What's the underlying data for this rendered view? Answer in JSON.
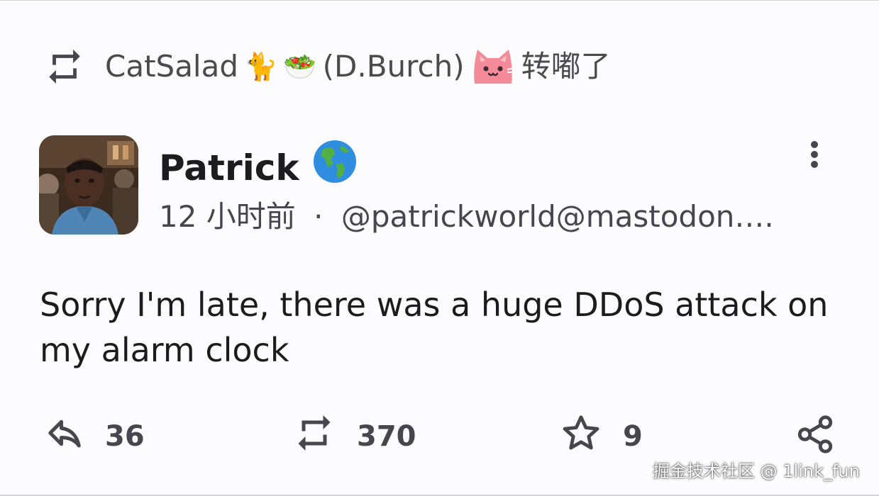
{
  "boost": {
    "icon": "repeat-icon",
    "display_name": "CatSalad",
    "name_emojis": [
      "🐈",
      "🥗"
    ],
    "handle_paren": "(D.Burch)",
    "custom_emoji": "pink-cat-emoji",
    "action_text": "转嘟了"
  },
  "post": {
    "author": {
      "name": "Patrick",
      "name_emoji": "🌎"
    },
    "meta": {
      "time": "12 小时前",
      "separator": "·",
      "account": "@patrickworld@mastodon…."
    },
    "body": "Sorry I'm late, there was a huge DDoS attack on my alarm clock"
  },
  "actions": {
    "reply": {
      "icon": "reply-icon",
      "count": "36"
    },
    "boost": {
      "icon": "repeat-icon",
      "count": "370"
    },
    "favourite": {
      "icon": "star-icon",
      "count": "9"
    },
    "share": {
      "icon": "share-icon"
    }
  },
  "watermark": "掘金技术社区 @ 1link_fun",
  "colors": {
    "background": "#fcfbfe",
    "text": "#1c1b1f",
    "muted": "#47464f"
  }
}
